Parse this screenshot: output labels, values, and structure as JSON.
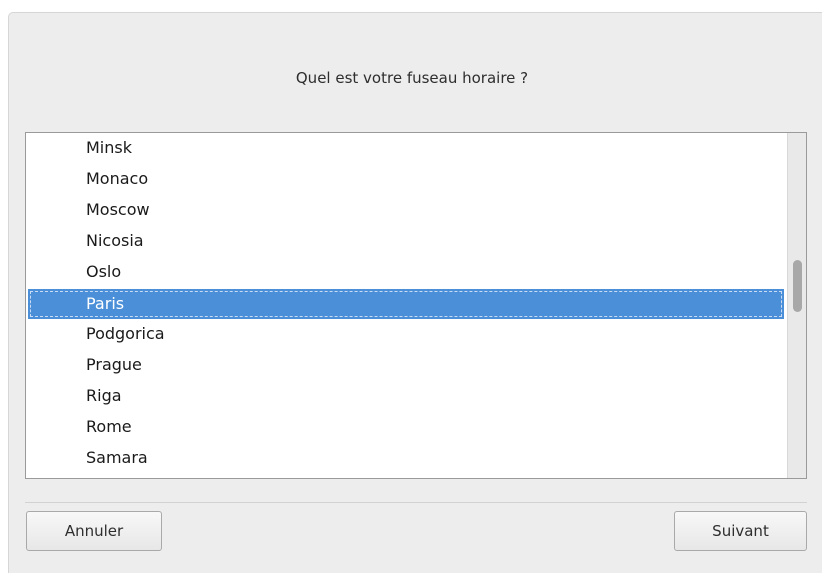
{
  "dialog": {
    "heading": "Quel est votre fuseau horaire ?"
  },
  "timezones": {
    "items": [
      {
        "label": "Minsk",
        "selected": false
      },
      {
        "label": "Monaco",
        "selected": false
      },
      {
        "label": "Moscow",
        "selected": false
      },
      {
        "label": "Nicosia",
        "selected": false
      },
      {
        "label": "Oslo",
        "selected": false
      },
      {
        "label": "Paris",
        "selected": true
      },
      {
        "label": "Podgorica",
        "selected": false
      },
      {
        "label": "Prague",
        "selected": false
      },
      {
        "label": "Riga",
        "selected": false
      },
      {
        "label": "Rome",
        "selected": false
      },
      {
        "label": "Samara",
        "selected": false
      }
    ],
    "selected_value": "Paris"
  },
  "buttons": {
    "cancel_label": "Annuler",
    "next_label": "Suivant"
  },
  "colors": {
    "selection": "#4a8fd8",
    "window_bg": "#ededed"
  }
}
